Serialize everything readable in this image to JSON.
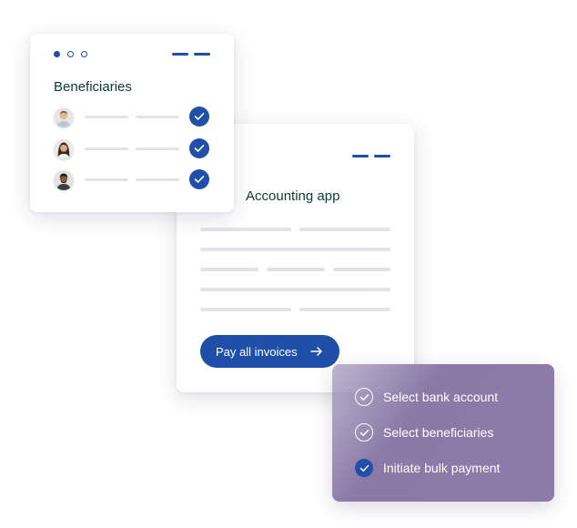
{
  "beneficiaries_card": {
    "title": "Beneficiaries",
    "window_dots": [
      "filled",
      "hollow",
      "hollow"
    ],
    "rows": [
      {
        "avatar": "person-avatar",
        "checked": true
      },
      {
        "avatar": "person-avatar",
        "checked": true
      },
      {
        "avatar": "person-avatar",
        "checked": true
      }
    ]
  },
  "accounting_card": {
    "title": "Accounting app",
    "pay_button_label": "Pay all invoices",
    "pay_button_icon": "arrow-right-icon"
  },
  "steps_card": {
    "steps": [
      {
        "label": "Select bank account",
        "status": "done-outline"
      },
      {
        "label": "Select beneficiaries",
        "status": "done-outline"
      },
      {
        "label": "Initiate bulk payment",
        "status": "active"
      }
    ]
  },
  "colors": {
    "brand_blue": "#1f4fa8",
    "title_green": "#0b3b33",
    "steps_purple": "#8b7aa8",
    "placeholder_gray": "#e3e4e8"
  }
}
